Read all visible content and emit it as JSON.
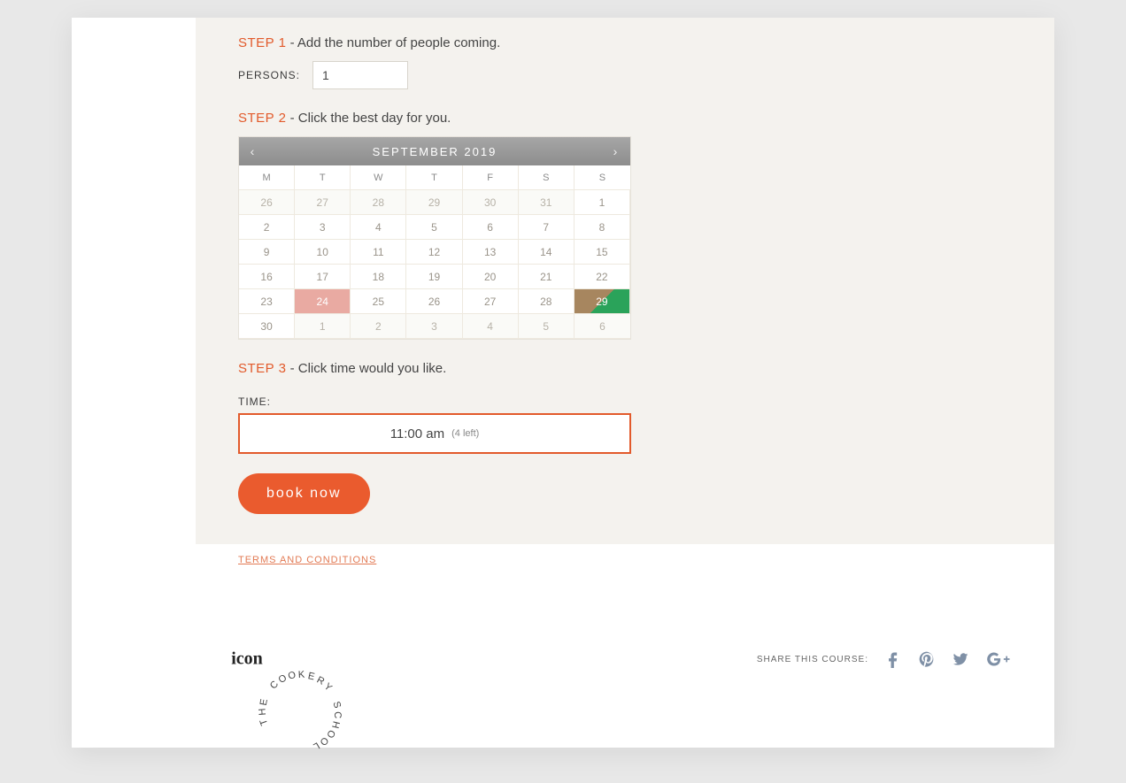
{
  "steps": {
    "s1": {
      "tag": "STEP 1",
      "text": " - Add the number of people coming."
    },
    "s2": {
      "tag": "STEP 2",
      "text": " - Click the best day for you."
    },
    "s3": {
      "tag": "STEP 3",
      "text": " - Click time would you like."
    }
  },
  "persons": {
    "label": "PERSONS:",
    "value": "1"
  },
  "calendar": {
    "title": "SEPTEMBER 2019",
    "prev": "‹",
    "next": "›",
    "dow": [
      "M",
      "T",
      "W",
      "T",
      "F",
      "S",
      "S"
    ],
    "rows": [
      [
        {
          "n": "26",
          "cls": "other"
        },
        {
          "n": "27",
          "cls": "other"
        },
        {
          "n": "28",
          "cls": "other"
        },
        {
          "n": "29",
          "cls": "other"
        },
        {
          "n": "30",
          "cls": "other"
        },
        {
          "n": "31",
          "cls": "other"
        },
        {
          "n": "1"
        }
      ],
      [
        {
          "n": "2"
        },
        {
          "n": "3"
        },
        {
          "n": "4"
        },
        {
          "n": "5"
        },
        {
          "n": "6"
        },
        {
          "n": "7"
        },
        {
          "n": "8"
        }
      ],
      [
        {
          "n": "9"
        },
        {
          "n": "10"
        },
        {
          "n": "11"
        },
        {
          "n": "12"
        },
        {
          "n": "13"
        },
        {
          "n": "14"
        },
        {
          "n": "15"
        }
      ],
      [
        {
          "n": "16"
        },
        {
          "n": "17"
        },
        {
          "n": "18"
        },
        {
          "n": "19"
        },
        {
          "n": "20"
        },
        {
          "n": "21"
        },
        {
          "n": "22"
        }
      ],
      [
        {
          "n": "23"
        },
        {
          "n": "24",
          "cls": "pink"
        },
        {
          "n": "25"
        },
        {
          "n": "26"
        },
        {
          "n": "27"
        },
        {
          "n": "28"
        },
        {
          "n": "29",
          "cls": "green"
        }
      ],
      [
        {
          "n": "30"
        },
        {
          "n": "1",
          "cls": "other"
        },
        {
          "n": "2",
          "cls": "other"
        },
        {
          "n": "3",
          "cls": "other"
        },
        {
          "n": "4",
          "cls": "other"
        },
        {
          "n": "5",
          "cls": "other"
        },
        {
          "n": "6",
          "cls": "other"
        }
      ]
    ]
  },
  "time": {
    "label": "TIME:",
    "slot": "11:00 am",
    "left": "(4 left)"
  },
  "book": "book now",
  "terms": "TERMS AND CONDITIONS",
  "logo": {
    "center": "icon",
    "ring": "THE COOKERY SCHOOL"
  },
  "share": {
    "label": "SHARE THIS COURSE:",
    "icons": [
      "facebook",
      "pinterest",
      "twitter",
      "google-plus"
    ]
  }
}
